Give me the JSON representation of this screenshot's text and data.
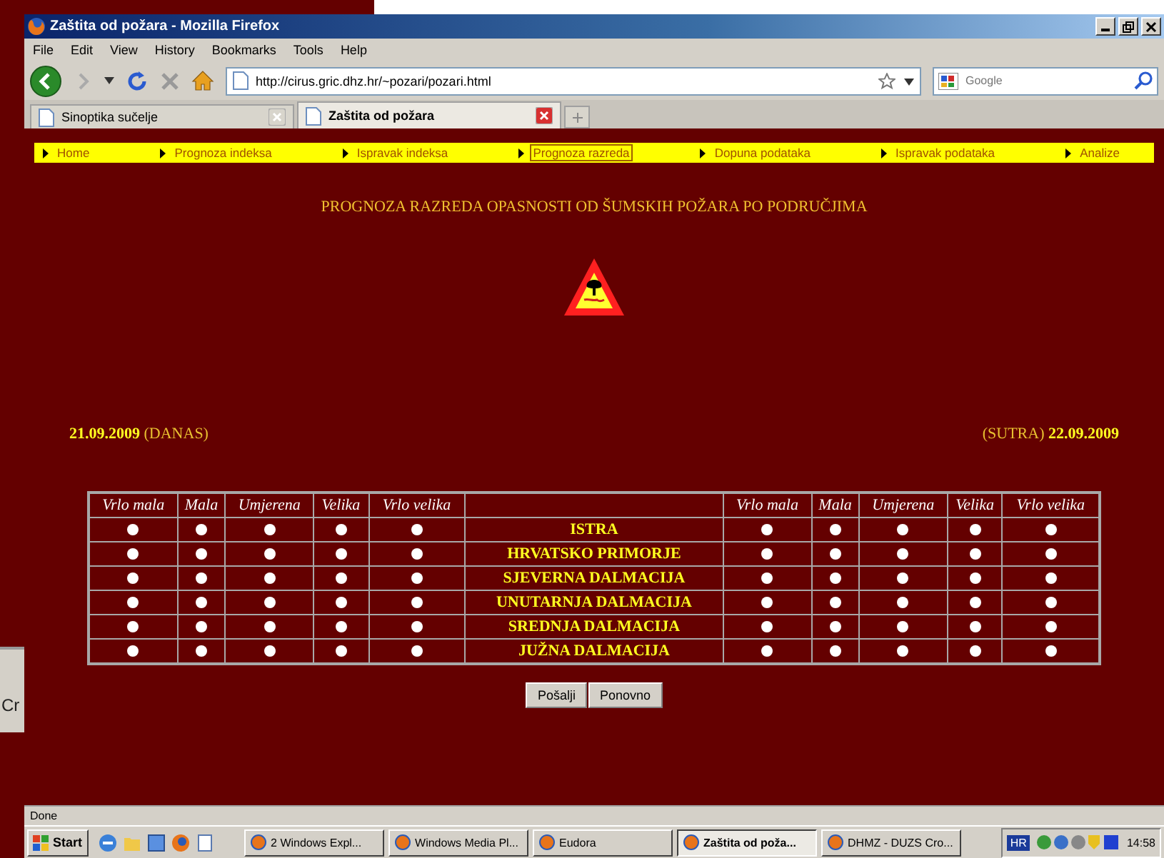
{
  "window": {
    "title": "Zaštita od požara - Mozilla Firefox"
  },
  "menu": [
    "File",
    "Edit",
    "View",
    "History",
    "Bookmarks",
    "Tools",
    "Help"
  ],
  "address": {
    "value": "http://cirus.gric.dhz.hr/~pozari/pozari.html"
  },
  "search": {
    "placeholder": "Google"
  },
  "tabs": [
    {
      "label": "Sinoptika sučelje",
      "selected": false
    },
    {
      "label": "Zaštita od požara",
      "selected": true
    }
  ],
  "nav": [
    {
      "label": "Home",
      "selected": false
    },
    {
      "label": "Prognoza indeksa",
      "selected": false
    },
    {
      "label": "Ispravak indeksa",
      "selected": false
    },
    {
      "label": "Prognoza razreda",
      "selected": true
    },
    {
      "label": "Dopuna podataka",
      "selected": false
    },
    {
      "label": "Ispravak podataka",
      "selected": false
    },
    {
      "label": "Analize",
      "selected": false
    }
  ],
  "heading": "PROGNOZA RAZREDA OPASNOSTI OD ŠUMSKIH POŽARA PO PODRUČJIMA",
  "date_today": "**21.09.2009** (DANAS)",
  "date_tomorrow": "(SUTRA) **22.09.2009**",
  "table": {
    "columns_left": [
      "Vrlo mala",
      "Mala",
      "Umjerena",
      "Velika",
      "Vrlo velika"
    ],
    "columns_right": [
      "Vrlo mala",
      "Mala",
      "Umjerena",
      "Velika",
      "Vrlo velika"
    ],
    "rows": [
      {
        "region": "ISTRA",
        "today": [
          {
            "selected": false
          },
          {
            "selected": false
          },
          {
            "selected": false
          },
          {
            "selected": false
          },
          {
            "selected": false
          }
        ],
        "tomorrow": [
          {
            "selected": false
          },
          {
            "selected": false
          },
          {
            "selected": false
          },
          {
            "selected": false
          },
          {
            "selected": false
          }
        ]
      },
      {
        "region": "HRVATSKO PRIMORJE",
        "today": [
          {
            "selected": false
          },
          {
            "selected": false
          },
          {
            "selected": false
          },
          {
            "selected": false
          },
          {
            "selected": false
          }
        ],
        "tomorrow": [
          {
            "selected": false
          },
          {
            "selected": false
          },
          {
            "selected": false
          },
          {
            "selected": false
          },
          {
            "selected": false
          }
        ]
      },
      {
        "region": "SJEVERNA DALMACIJA",
        "today": [
          {
            "selected": false
          },
          {
            "selected": false
          },
          {
            "selected": false
          },
          {
            "selected": false
          },
          {
            "selected": false
          }
        ],
        "tomorrow": [
          {
            "selected": false
          },
          {
            "selected": false
          },
          {
            "selected": false
          },
          {
            "selected": false
          },
          {
            "selected": false
          }
        ]
      },
      {
        "region": "UNUTARNJA DALMACIJA",
        "today": [
          {
            "selected": false
          },
          {
            "selected": false
          },
          {
            "selected": false
          },
          {
            "selected": false
          },
          {
            "selected": false
          }
        ],
        "tomorrow": [
          {
            "selected": false
          },
          {
            "selected": false
          },
          {
            "selected": false
          },
          {
            "selected": false
          },
          {
            "selected": false
          }
        ]
      },
      {
        "region": "SREDNJA DALMACIJA",
        "today": [
          {
            "selected": false
          },
          {
            "selected": false
          },
          {
            "selected": false
          },
          {
            "selected": false
          },
          {
            "selected": false
          }
        ],
        "tomorrow": [
          {
            "selected": false
          },
          {
            "selected": false
          },
          {
            "selected": false
          },
          {
            "selected": false
          },
          {
            "selected": false
          }
        ]
      },
      {
        "region": "JUŽNA DALMACIJA",
        "today": [
          {
            "selected": false
          },
          {
            "selected": false
          },
          {
            "selected": false
          },
          {
            "selected": false
          },
          {
            "selected": false
          }
        ],
        "tomorrow": [
          {
            "selected": false
          },
          {
            "selected": false
          },
          {
            "selected": false
          },
          {
            "selected": false
          },
          {
            "selected": false
          }
        ]
      }
    ]
  },
  "buttons": [
    "Pošalji",
    "Ponovno"
  ],
  "status_bar": "Done",
  "background_window": {
    "text": "Cr"
  },
  "taskbar": {
    "start": "Start",
    "tasks": [
      {
        "label": "2 Windows Expl...",
        "selected": false
      },
      {
        "label": "Windows Media Pl...",
        "selected": false
      },
      {
        "label": "Eudora",
        "selected": false
      },
      {
        "label": "Zaštita od poža...",
        "selected": true
      },
      {
        "label": "DHMZ - DUZS Cro...",
        "selected": false
      }
    ],
    "language": "HR",
    "clock": "14:58"
  }
}
